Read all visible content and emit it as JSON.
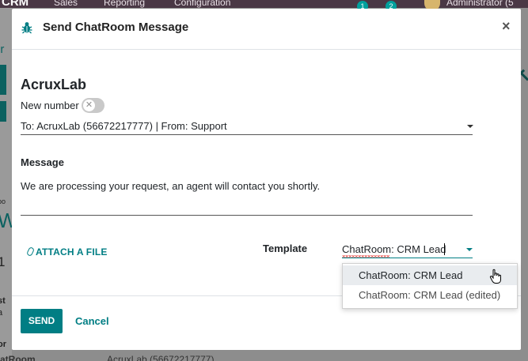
{
  "background": {
    "brand": "CRM",
    "nav": [
      "Sales",
      "Reporting",
      "Configuration"
    ],
    "badges": [
      "1",
      "2"
    ],
    "user": "Administrator (5",
    "bottom_left": "atRoom",
    "bottom_value": "AcruxLab (56672217777)"
  },
  "dialog": {
    "title": "Send ChatRoom Message",
    "close_label": "×",
    "partner_name": "AcruxLab",
    "new_number_label": "New number",
    "connector_value": "To: AcruxLab (56672217777) | From: Support",
    "message_label": "Message",
    "message_text": "We are processing your request, an agent will contact you shortly.",
    "attach_label": "ATTACH A FILE",
    "template_label": "Template",
    "template_value": "ChatRoom: CRM Lead",
    "send_label": "SEND",
    "cancel_label": "Cancel"
  },
  "dropdown": {
    "options": [
      "ChatRoom: CRM Lead",
      "ChatRoom: CRM Lead (edited)"
    ],
    "highlighted_index": 0
  },
  "colors": {
    "accent": "#017e84",
    "topbar": "#4a3845",
    "overlay": "#8d8d8d"
  },
  "icons": {
    "title": "bug-icon",
    "close": "close-icon",
    "toggle": "x-icon",
    "attach": "paperclip-icon",
    "dropdown": "caret-down-icon",
    "pointer": "hand-cursor-icon"
  }
}
